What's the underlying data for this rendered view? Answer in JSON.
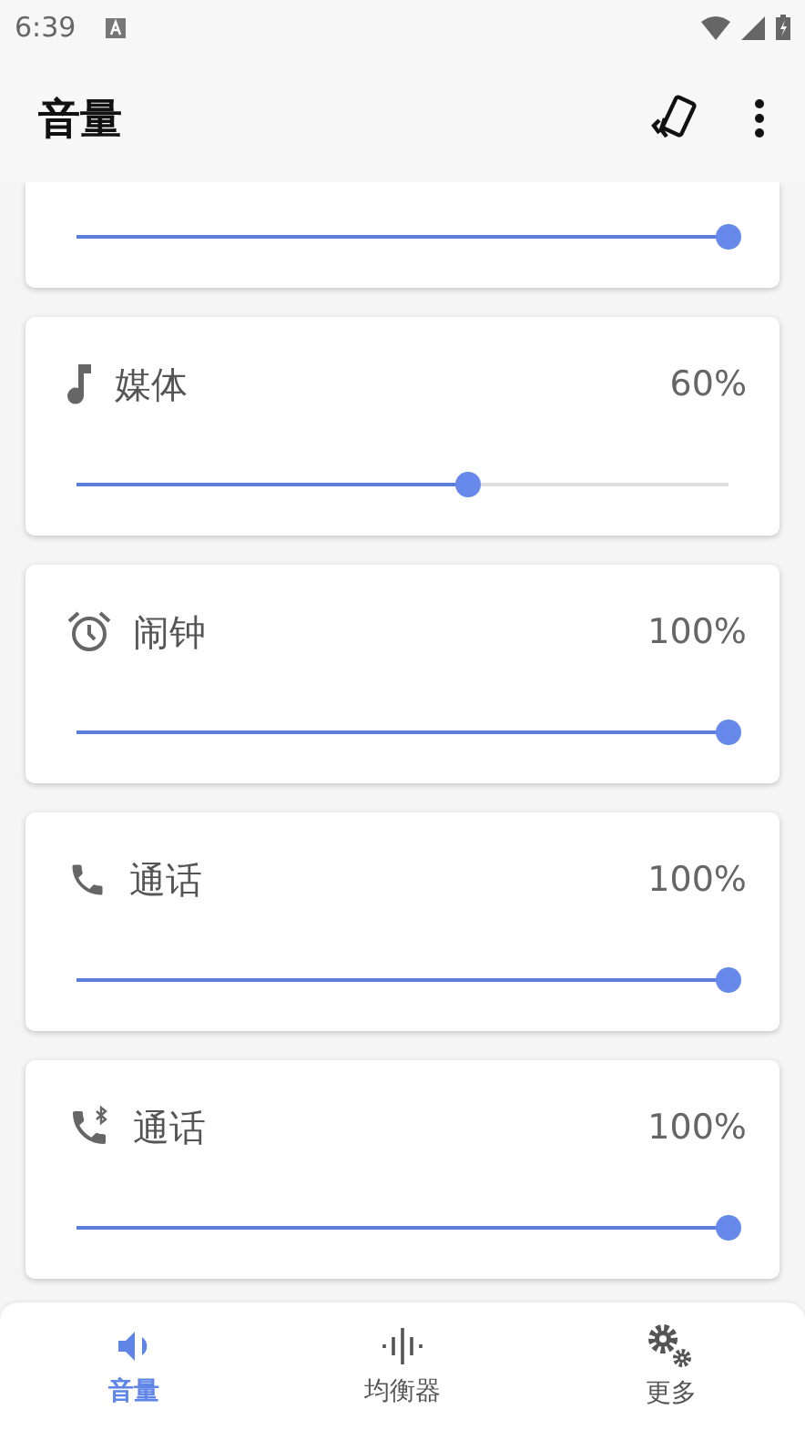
{
  "status_bar": {
    "time": "6:39"
  },
  "app_bar": {
    "title": "音量"
  },
  "cards": [
    {
      "kind": "partial",
      "level": 1
    },
    {
      "kind": "media",
      "label": "媒体",
      "reading": "60%",
      "level": 0.6
    },
    {
      "kind": "alarm",
      "label": "闹钟",
      "reading": "100%",
      "level": 1
    },
    {
      "kind": "call",
      "label": "通话",
      "reading": "100%",
      "level": 1
    },
    {
      "kind": "bluetooth_call",
      "label": "通话",
      "reading": "100%",
      "level": 1
    }
  ],
  "nav": [
    {
      "kind": "volume",
      "label": "音量",
      "selected": true
    },
    {
      "kind": "equalizer",
      "label": "均衡器",
      "selected": false
    },
    {
      "kind": "more",
      "label": "更多",
      "selected": false
    }
  ]
}
